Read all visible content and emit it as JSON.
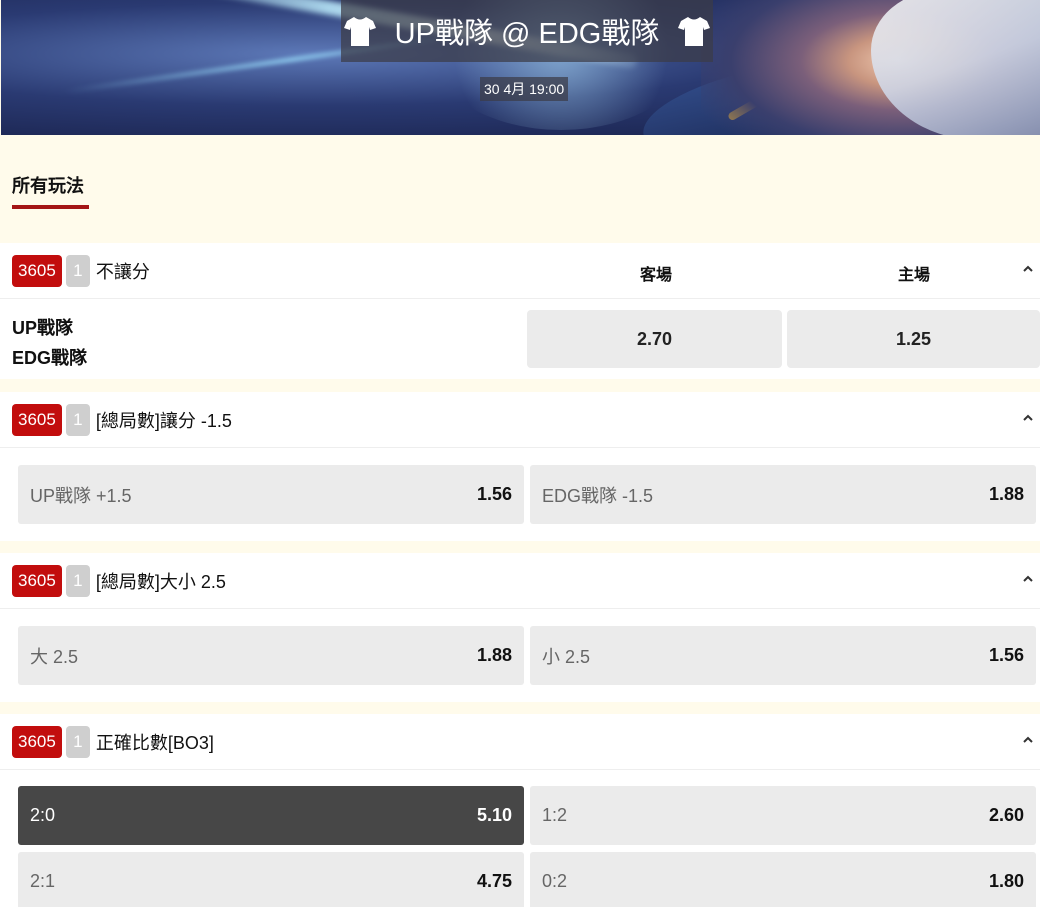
{
  "match": {
    "title": "UP戰隊 @ EDG戰隊",
    "datetime": "30 4月 19:00"
  },
  "tabs": {
    "all_label": "所有玩法"
  },
  "markets": [
    {
      "id": "3605",
      "count": "1",
      "name": "不讓分",
      "col_away": "客場",
      "col_home": "主場",
      "team1": "UP戰隊",
      "team2": "EDG戰隊",
      "odd_away": "2.70",
      "odd_home": "1.25"
    },
    {
      "id": "3605",
      "count": "1",
      "name": "[總局數]讓分 -1.5",
      "selections": [
        {
          "label": "UP戰隊 +1.5",
          "odd": "1.56"
        },
        {
          "label": "EDG戰隊 -1.5",
          "odd": "1.88"
        }
      ]
    },
    {
      "id": "3605",
      "count": "1",
      "name": "[總局數]大小 2.5",
      "selections": [
        {
          "label": "大 2.5",
          "odd": "1.88"
        },
        {
          "label": "小 2.5",
          "odd": "1.56"
        }
      ]
    },
    {
      "id": "3605",
      "count": "1",
      "name": "正確比數[BO3]",
      "selections": [
        {
          "label": "2:0",
          "odd": "5.10",
          "selected": true
        },
        {
          "label": "1:2",
          "odd": "2.60"
        },
        {
          "label": "2:1",
          "odd": "4.75"
        },
        {
          "label": "0:2",
          "odd": "1.80"
        }
      ]
    }
  ],
  "colors": {
    "accent": "#c20d0d",
    "selected_bg": "#474747",
    "page_bg": "#fffbeb"
  },
  "icons": {
    "jersey": "jersey-icon",
    "collapse": "chevron-up-icon"
  }
}
